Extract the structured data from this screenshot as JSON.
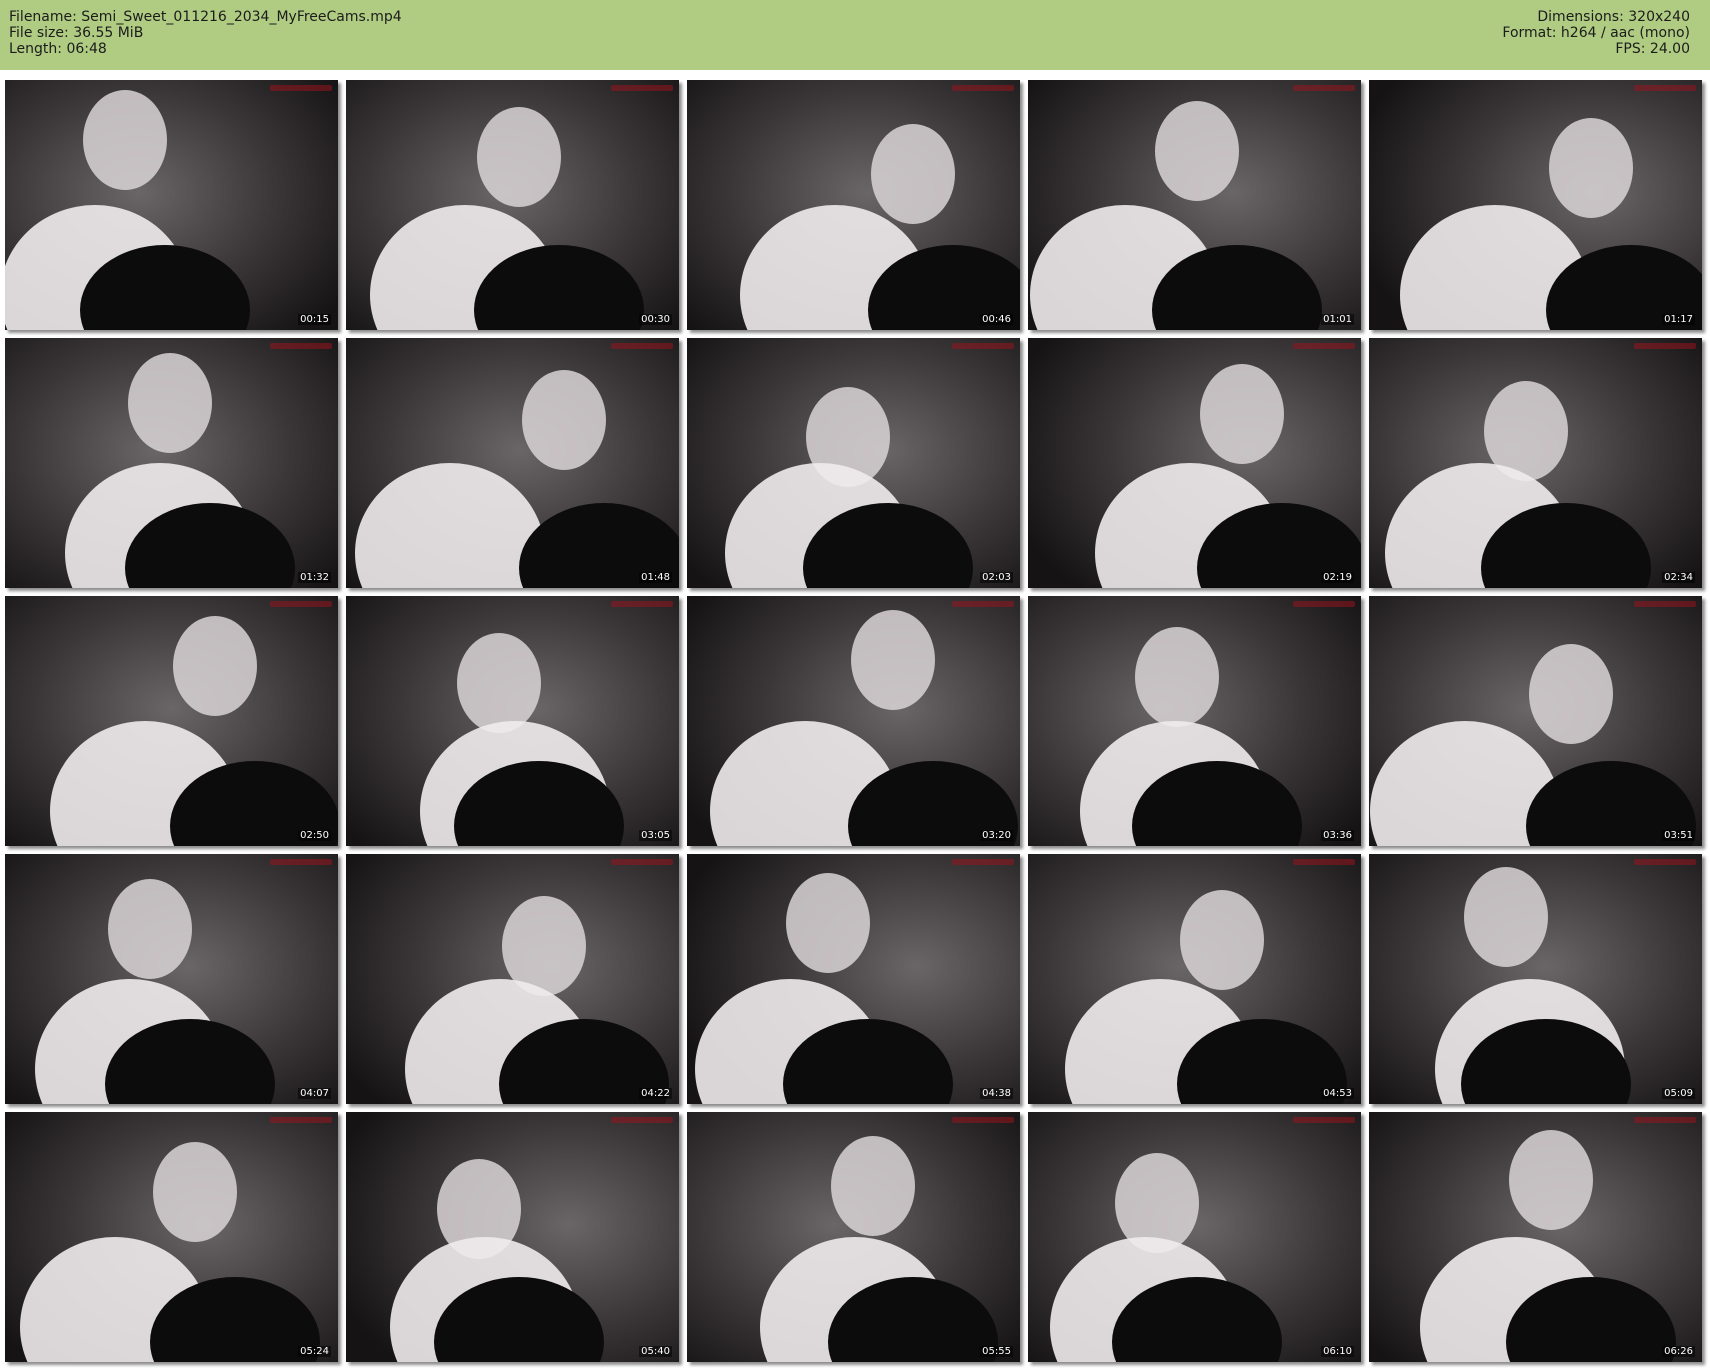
{
  "header": {
    "filename": "Filename: Semi_Sweet_011216_2034_MyFreeCams.mp4",
    "file_size": "File size: 36.55 MiB",
    "length": "Length: 06:48",
    "dimensions": "Dimensions: 320x240",
    "format": "Format: h264 / aac (mono)",
    "fps": "FPS: 24.00"
  },
  "colors": {
    "header_background": "#b0cc82",
    "page_background": "#ffffff"
  },
  "thumbnails": [
    {
      "timestamp": "00:15"
    },
    {
      "timestamp": "00:30"
    },
    {
      "timestamp": "00:46"
    },
    {
      "timestamp": "01:01"
    },
    {
      "timestamp": "01:17"
    },
    {
      "timestamp": "01:32"
    },
    {
      "timestamp": "01:48"
    },
    {
      "timestamp": "02:03"
    },
    {
      "timestamp": "02:19"
    },
    {
      "timestamp": "02:34"
    },
    {
      "timestamp": "02:50"
    },
    {
      "timestamp": "03:05"
    },
    {
      "timestamp": "03:20"
    },
    {
      "timestamp": "03:36"
    },
    {
      "timestamp": "03:51"
    },
    {
      "timestamp": "04:07"
    },
    {
      "timestamp": "04:22"
    },
    {
      "timestamp": "04:38"
    },
    {
      "timestamp": "04:53"
    },
    {
      "timestamp": "05:09"
    },
    {
      "timestamp": "05:24"
    },
    {
      "timestamp": "05:40"
    },
    {
      "timestamp": "05:55"
    },
    {
      "timestamp": "06:10"
    },
    {
      "timestamp": "06:26"
    }
  ]
}
